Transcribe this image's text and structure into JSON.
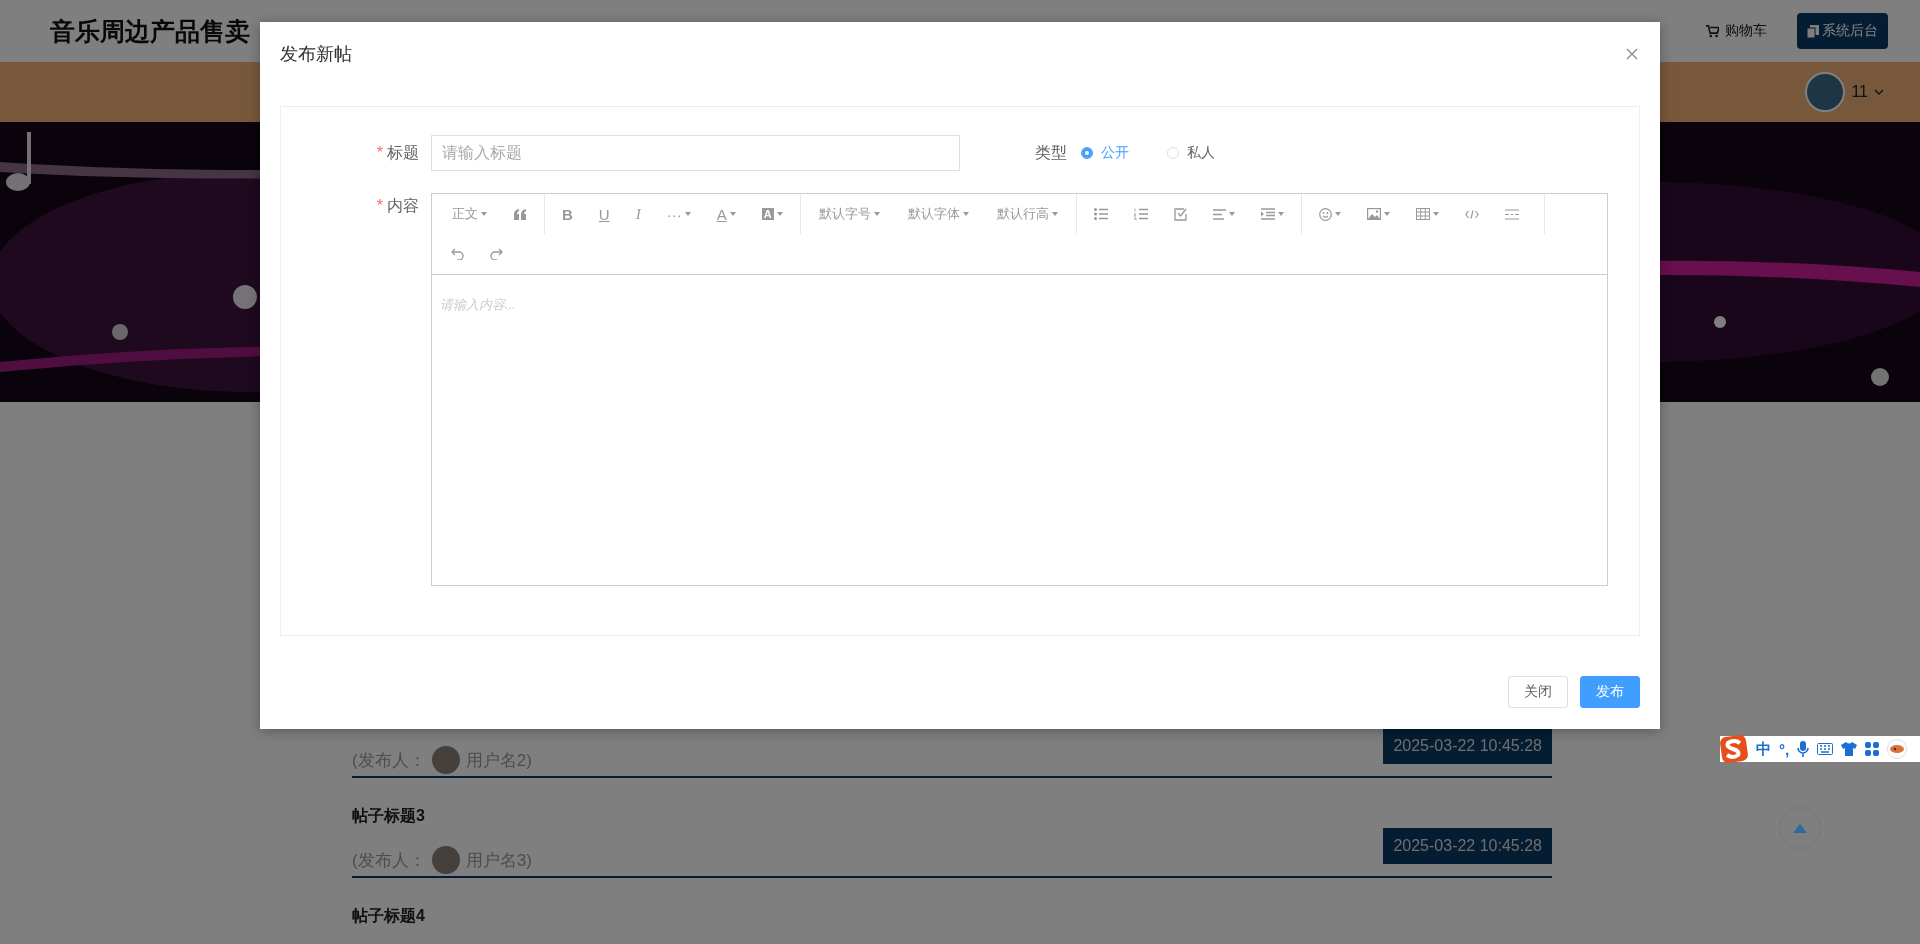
{
  "header": {
    "site_title": "音乐周边产品售卖",
    "cart": "购物车",
    "admin_button": "系统后台"
  },
  "nav": {
    "user": "11"
  },
  "posts": [
    {
      "publisher_prefix": "(发布人：",
      "publisher": "用户名2)",
      "date": "2025-03-22 10:45:28"
    },
    {
      "title": "帖子标题3",
      "publisher_prefix": "(发布人：",
      "publisher": "用户名3)",
      "date": "2025-03-22 10:45:28"
    },
    {
      "title": "帖子标题4"
    }
  ],
  "dialog": {
    "title": "发布新帖",
    "title_field": {
      "required_mark": "*",
      "label": "标题",
      "placeholder": "请输入标题"
    },
    "type_field": {
      "label": "类型",
      "options": [
        {
          "label": "公开",
          "selected": true
        },
        {
          "label": "私人",
          "selected": false
        }
      ]
    },
    "content_field": {
      "required_mark": "*",
      "label": "内容",
      "placeholder": "请输入内容..."
    },
    "toolbar": {
      "heading": "正文",
      "bold": "B",
      "underline": "U",
      "italic": "I",
      "more": "···",
      "font_color": "A",
      "background_color": "A",
      "font_size": "默认字号",
      "font_family": "默认字体",
      "line_height": "默认行高"
    },
    "buttons": [
      {
        "label": "关闭",
        "kind": "secondary"
      },
      {
        "label": "发布",
        "kind": "primary"
      }
    ]
  },
  "ime": {
    "mode": "中",
    "punctuation": "°,"
  }
}
